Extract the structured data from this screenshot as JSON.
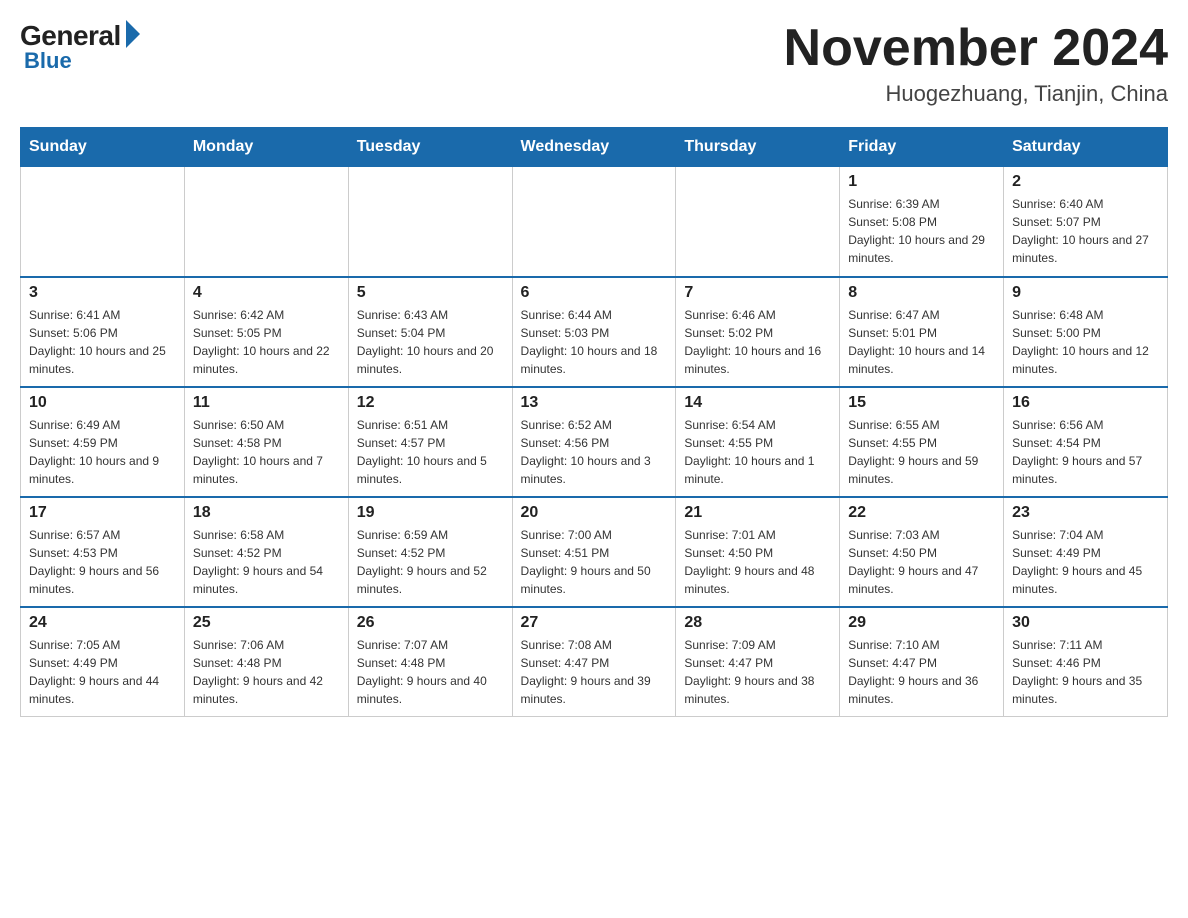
{
  "header": {
    "logo_general": "General",
    "logo_blue": "Blue",
    "month_title": "November 2024",
    "location": "Huogezhuang, Tianjin, China"
  },
  "weekdays": [
    "Sunday",
    "Monday",
    "Tuesday",
    "Wednesday",
    "Thursday",
    "Friday",
    "Saturday"
  ],
  "weeks": [
    [
      {
        "day": "",
        "info": ""
      },
      {
        "day": "",
        "info": ""
      },
      {
        "day": "",
        "info": ""
      },
      {
        "day": "",
        "info": ""
      },
      {
        "day": "",
        "info": ""
      },
      {
        "day": "1",
        "info": "Sunrise: 6:39 AM\nSunset: 5:08 PM\nDaylight: 10 hours and 29 minutes."
      },
      {
        "day": "2",
        "info": "Sunrise: 6:40 AM\nSunset: 5:07 PM\nDaylight: 10 hours and 27 minutes."
      }
    ],
    [
      {
        "day": "3",
        "info": "Sunrise: 6:41 AM\nSunset: 5:06 PM\nDaylight: 10 hours and 25 minutes."
      },
      {
        "day": "4",
        "info": "Sunrise: 6:42 AM\nSunset: 5:05 PM\nDaylight: 10 hours and 22 minutes."
      },
      {
        "day": "5",
        "info": "Sunrise: 6:43 AM\nSunset: 5:04 PM\nDaylight: 10 hours and 20 minutes."
      },
      {
        "day": "6",
        "info": "Sunrise: 6:44 AM\nSunset: 5:03 PM\nDaylight: 10 hours and 18 minutes."
      },
      {
        "day": "7",
        "info": "Sunrise: 6:46 AM\nSunset: 5:02 PM\nDaylight: 10 hours and 16 minutes."
      },
      {
        "day": "8",
        "info": "Sunrise: 6:47 AM\nSunset: 5:01 PM\nDaylight: 10 hours and 14 minutes."
      },
      {
        "day": "9",
        "info": "Sunrise: 6:48 AM\nSunset: 5:00 PM\nDaylight: 10 hours and 12 minutes."
      }
    ],
    [
      {
        "day": "10",
        "info": "Sunrise: 6:49 AM\nSunset: 4:59 PM\nDaylight: 10 hours and 9 minutes."
      },
      {
        "day": "11",
        "info": "Sunrise: 6:50 AM\nSunset: 4:58 PM\nDaylight: 10 hours and 7 minutes."
      },
      {
        "day": "12",
        "info": "Sunrise: 6:51 AM\nSunset: 4:57 PM\nDaylight: 10 hours and 5 minutes."
      },
      {
        "day": "13",
        "info": "Sunrise: 6:52 AM\nSunset: 4:56 PM\nDaylight: 10 hours and 3 minutes."
      },
      {
        "day": "14",
        "info": "Sunrise: 6:54 AM\nSunset: 4:55 PM\nDaylight: 10 hours and 1 minute."
      },
      {
        "day": "15",
        "info": "Sunrise: 6:55 AM\nSunset: 4:55 PM\nDaylight: 9 hours and 59 minutes."
      },
      {
        "day": "16",
        "info": "Sunrise: 6:56 AM\nSunset: 4:54 PM\nDaylight: 9 hours and 57 minutes."
      }
    ],
    [
      {
        "day": "17",
        "info": "Sunrise: 6:57 AM\nSunset: 4:53 PM\nDaylight: 9 hours and 56 minutes."
      },
      {
        "day": "18",
        "info": "Sunrise: 6:58 AM\nSunset: 4:52 PM\nDaylight: 9 hours and 54 minutes."
      },
      {
        "day": "19",
        "info": "Sunrise: 6:59 AM\nSunset: 4:52 PM\nDaylight: 9 hours and 52 minutes."
      },
      {
        "day": "20",
        "info": "Sunrise: 7:00 AM\nSunset: 4:51 PM\nDaylight: 9 hours and 50 minutes."
      },
      {
        "day": "21",
        "info": "Sunrise: 7:01 AM\nSunset: 4:50 PM\nDaylight: 9 hours and 48 minutes."
      },
      {
        "day": "22",
        "info": "Sunrise: 7:03 AM\nSunset: 4:50 PM\nDaylight: 9 hours and 47 minutes."
      },
      {
        "day": "23",
        "info": "Sunrise: 7:04 AM\nSunset: 4:49 PM\nDaylight: 9 hours and 45 minutes."
      }
    ],
    [
      {
        "day": "24",
        "info": "Sunrise: 7:05 AM\nSunset: 4:49 PM\nDaylight: 9 hours and 44 minutes."
      },
      {
        "day": "25",
        "info": "Sunrise: 7:06 AM\nSunset: 4:48 PM\nDaylight: 9 hours and 42 minutes."
      },
      {
        "day": "26",
        "info": "Sunrise: 7:07 AM\nSunset: 4:48 PM\nDaylight: 9 hours and 40 minutes."
      },
      {
        "day": "27",
        "info": "Sunrise: 7:08 AM\nSunset: 4:47 PM\nDaylight: 9 hours and 39 minutes."
      },
      {
        "day": "28",
        "info": "Sunrise: 7:09 AM\nSunset: 4:47 PM\nDaylight: 9 hours and 38 minutes."
      },
      {
        "day": "29",
        "info": "Sunrise: 7:10 AM\nSunset: 4:47 PM\nDaylight: 9 hours and 36 minutes."
      },
      {
        "day": "30",
        "info": "Sunrise: 7:11 AM\nSunset: 4:46 PM\nDaylight: 9 hours and 35 minutes."
      }
    ]
  ]
}
